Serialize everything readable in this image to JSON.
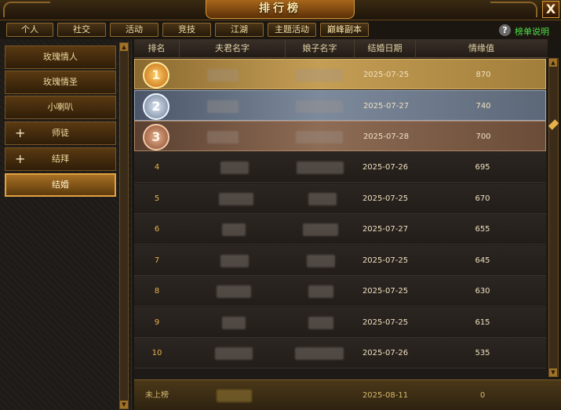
{
  "window": {
    "title": "排行榜",
    "close_label": "X"
  },
  "tabs": [
    "个人",
    "社交",
    "活动",
    "竞技",
    "江湖",
    "主题活动",
    "巅峰副本"
  ],
  "help": {
    "icon": "?",
    "label": "榜单说明"
  },
  "categories": [
    {
      "label": "玫瑰情人",
      "expandable": false,
      "selected": false
    },
    {
      "label": "玫瑰情圣",
      "expandable": false,
      "selected": false
    },
    {
      "label": "小喇叭",
      "expandable": false,
      "selected": false
    },
    {
      "label": "师徒",
      "expandable": true,
      "selected": false
    },
    {
      "label": "结拜",
      "expandable": true,
      "selected": false
    },
    {
      "label": "结婚",
      "expandable": false,
      "selected": true
    }
  ],
  "plus_symbol": "+",
  "table": {
    "headers": [
      "排名",
      "夫君名字",
      "娘子名字",
      "结婚日期",
      "情缘值"
    ],
    "rows": [
      {
        "rank": "1",
        "date": "2025-07-25",
        "value": "870"
      },
      {
        "rank": "2",
        "date": "2025-07-27",
        "value": "740"
      },
      {
        "rank": "3",
        "date": "2025-07-28",
        "value": "700"
      },
      {
        "rank": "4",
        "date": "2025-07-26",
        "value": "695"
      },
      {
        "rank": "5",
        "date": "2025-07-25",
        "value": "670"
      },
      {
        "rank": "6",
        "date": "2025-07-27",
        "value": "655"
      },
      {
        "rank": "7",
        "date": "2025-07-25",
        "value": "645"
      },
      {
        "rank": "8",
        "date": "2025-07-25",
        "value": "630"
      },
      {
        "rank": "9",
        "date": "2025-07-25",
        "value": "615"
      },
      {
        "rank": "10",
        "date": "2025-07-26",
        "value": "535"
      }
    ]
  },
  "footer": {
    "rank": "未上榜",
    "date": "2025-08-11",
    "value": "0"
  },
  "colors": {
    "accent": "#e0a242",
    "help_text": "#4fe34a"
  }
}
